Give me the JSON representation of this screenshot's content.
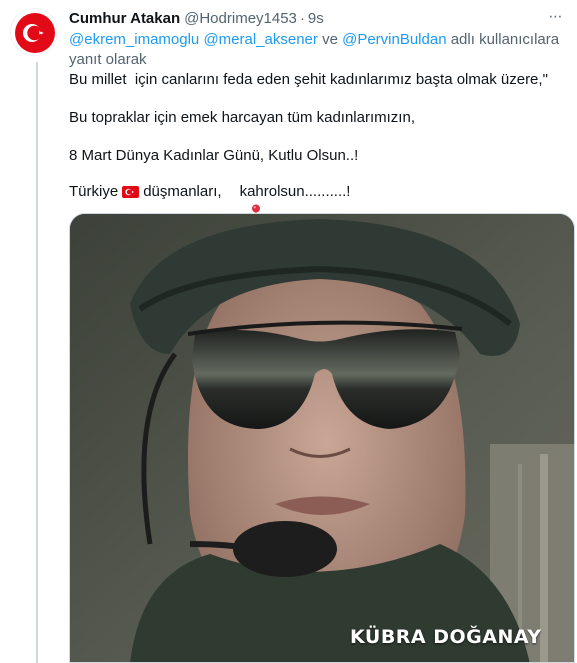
{
  "tweet": {
    "author_name": "Cumhur Atakan",
    "author_handle": "@Hodrimey1453",
    "separator": "·",
    "time": "9s",
    "more_icon": "⋯",
    "reply_context": {
      "mentions": [
        "@ekrem_imamoglu",
        "@meral_aksener",
        "@PervinBuldan"
      ],
      "joiner": "ve",
      "suffix": "adlı kullanıcılara yanıt olarak"
    },
    "lines": {
      "line1": "Bu millet  için canlarını feda eden şehit kadınlarımız başta olmak üzere,\"",
      "line2": "Bu topraklar için emek harcayan tüm kadınlarımızın,",
      "line3": "8 Mart Dünya Kadınlar Günü, Kutlu Olsun..!",
      "line4_a": "Türkiye",
      "line4_b": "düşmanları,",
      "line4_c": "kahrolsun..........!"
    },
    "media": {
      "caption": "KÜBRA DOĞANAY"
    },
    "colors": {
      "link": "#1d9bf0",
      "secondary_text": "#536471",
      "flag_red": "#e30a17"
    }
  }
}
